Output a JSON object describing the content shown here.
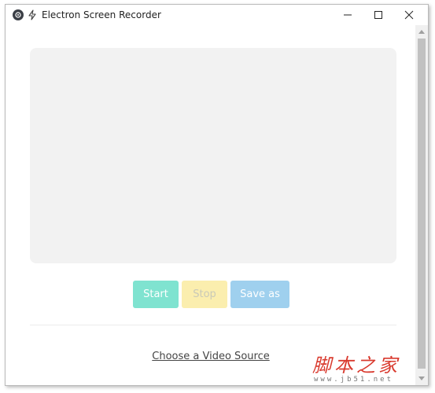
{
  "window": {
    "title": "Electron Screen Recorder",
    "app_icon": "app-logo-icon",
    "title_icon": "lightning-bolt-icon"
  },
  "controls": {
    "start_label": "Start",
    "stop_label": "Stop",
    "save_label": "Save as"
  },
  "video_source_label": "Choose a Video Source",
  "watermark": {
    "chars": "脚本之家",
    "url": "www.jb51.net"
  },
  "colors": {
    "start": "#7fe3d0",
    "stop": "#fbeeae",
    "save": "#9fd0ee",
    "video_area": "#f2f2f2",
    "watermark": "#d93a2e"
  }
}
